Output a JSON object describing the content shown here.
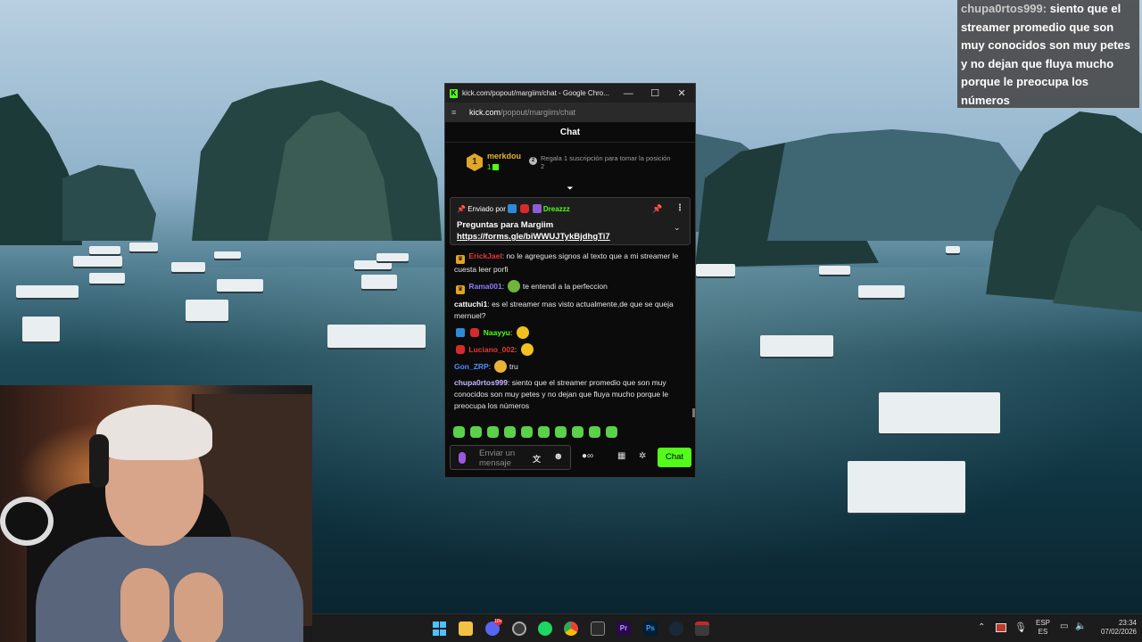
{
  "overlay": {
    "comment_user": "chupa0rtos999:",
    "comment_text": "siento que el streamer promedio que son muy conocidos son muy petes y no dejan que fluya mucho porque le preocupa los números"
  },
  "window": {
    "title": "kick.com/popout/margiim/chat - Google Chro...",
    "minimize": "—",
    "maximize": "☐",
    "close": "✕",
    "url_domain": "kick.com",
    "url_path": "/popout/margiim/chat"
  },
  "chat": {
    "header": "Chat",
    "leaderboard": {
      "rank": "1",
      "user": "merkdou",
      "count": "1",
      "info_icon": "2",
      "info": "Regala 1 suscripción para tomar la posición 2"
    },
    "pinned": {
      "sent_by": "Enviado por",
      "user": "Dreazzz",
      "title": "Preguntas para Margiim",
      "link": "https://forms.gle/biWWUJTykBjdhgTi7"
    },
    "messages": [
      {
        "user": "ErickJael",
        "color": "#e53935",
        "text": "no le agregues signos al texto que a mi streamer le cuesta leer porfi"
      },
      {
        "user": "Rama001",
        "color": "#8f7cff",
        "text": "te entendi a la perfeccion"
      },
      {
        "user": "cattuchi1",
        "color": "#ffffff",
        "text": "es el streamer mas visto actualmente,de que se queja mernuel?"
      },
      {
        "user": "Naayyu",
        "color": "#53fc18",
        "text": ""
      },
      {
        "user": "Luciano_002",
        "color": "#e53935",
        "text": ""
      },
      {
        "user": "Gon_ZRP",
        "color": "#4f8cff",
        "text": "tru"
      },
      {
        "user": "chupa0rtos999",
        "color": "#c7b8ff",
        "text": "siento que el streamer promedio que son muy conocidos son muy petes y no dejan que fluya mucho porque le preocupa los números"
      }
    ],
    "composer_placeholder": "Enviar un mensaje",
    "send_label": "Chat"
  },
  "taskbar": {
    "lang_top": "ESP",
    "lang_bottom": "ES",
    "time": "23:34",
    "date": "07/02/2026",
    "discord_badge": "10+"
  },
  "colors": {
    "kick_green": "#53fc18",
    "chat_bg": "#0b0b0b"
  }
}
